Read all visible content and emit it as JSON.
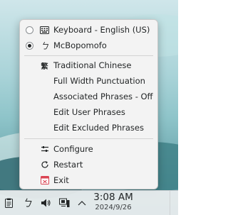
{
  "menu": {
    "input_methods": [
      {
        "label": "Keyboard - English (US)",
        "selected": false,
        "icon": "keyboard-icon"
      },
      {
        "label": "McBopomofo",
        "selected": true,
        "icon": "bopomofo-icon"
      }
    ],
    "options": [
      {
        "label": "Traditional Chinese",
        "icon": "traditional-chinese-icon"
      },
      {
        "label": "Full Width Punctuation"
      },
      {
        "label": "Associated Phrases - Off"
      },
      {
        "label": "Edit User Phrases"
      },
      {
        "label": "Edit Excluded Phrases"
      }
    ],
    "actions": [
      {
        "label": "Configure",
        "icon": "configure-icon"
      },
      {
        "label": "Restart",
        "icon": "restart-icon"
      },
      {
        "label": "Exit",
        "icon": "exit-icon"
      }
    ]
  },
  "taskbar": {
    "time": "3:08 AM",
    "date": "2024/9/26",
    "tray_icons": [
      "clipboard-icon",
      "input-method-icon",
      "volume-icon",
      "network-icon",
      "expand-tray-icon"
    ]
  },
  "colors": {
    "menu_bg": "#f3f3f3",
    "text": "#232627",
    "exit_icon": "#da4453"
  }
}
